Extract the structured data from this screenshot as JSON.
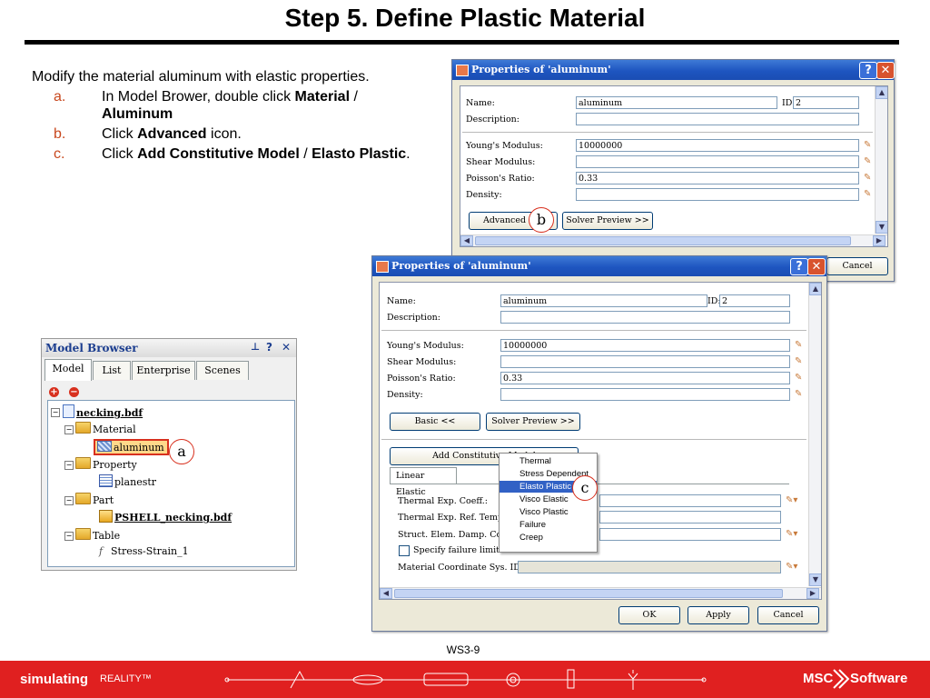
{
  "slide": {
    "title": "Step 5. Define Plastic Material",
    "intro": "Modify the material aluminum with elastic properties.",
    "steps": [
      {
        "marker": "a.",
        "parts": [
          "In Model Brower, double click ",
          "Material",
          " / ",
          "Aluminum"
        ]
      },
      {
        "marker": "b.",
        "parts": [
          "Click ",
          "Advanced",
          " icon."
        ]
      },
      {
        "marker": "c.",
        "parts": [
          "Click ",
          "Add Constitutive Model",
          " / ",
          "Elasto Plastic",
          "."
        ]
      }
    ],
    "page_label": "WS3-9"
  },
  "dialog_back": {
    "title": "Properties of 'aluminum'",
    "help": "?",
    "close": "✕",
    "name_label": "Name:",
    "name_value": "aluminum",
    "id_label": "ID:",
    "id_value": "2",
    "description_label": "Description:",
    "youngs_label": "Young's Modulus:",
    "youngs_value": "10000000",
    "shear_label": "Shear Modulus:",
    "poisson_label": "Poisson's Ratio:",
    "poisson_value": "0.33",
    "density_label": "Density:",
    "advanced_button": "Advanced >>",
    "solver_preview_button": "Solver Preview >>",
    "cancel_button": "Cancel",
    "callout": "b"
  },
  "dialog_front": {
    "title": "Properties of 'aluminum'",
    "help": "?",
    "close": "✕",
    "name_label": "Name:",
    "name_value": "aluminum",
    "id_label": "ID:",
    "id_value": "2",
    "description_label": "Description:",
    "youngs_label": "Young's Modulus:",
    "youngs_value": "10000000",
    "shear_label": "Shear Modulus:",
    "poisson_label": "Poisson's Ratio:",
    "poisson_value": "0.33",
    "density_label": "Density:",
    "basic_button": "Basic <<",
    "solver_preview_button": "Solver Preview >>",
    "add_constitutive_button": "Add Constitutive Model",
    "tab_linear_elastic": "Linear Elastic",
    "thermal_exp_label": "Thermal Exp. Coeff.:",
    "thermal_ref_label": "Thermal Exp. Ref. Temp.:",
    "struct_damp_label": "Struct. Elem. Damp. Coeff.:",
    "failure_limits_label": "Specify failure limits",
    "material_coord_label": "Material Coordinate Sys. ID:",
    "ok_button": "OK",
    "apply_button": "Apply",
    "cancel_button": "Cancel",
    "callout": "c",
    "menu_items": [
      "Thermal",
      "Stress Dependent",
      "Elasto Plastic",
      "Visco Elastic",
      "Visco Plastic",
      "Failure",
      "Creep"
    ],
    "menu_selected": "Elasto Plastic"
  },
  "model_browser": {
    "title": "Model Browser",
    "header_icons": [
      "pin-icon",
      "help-icon",
      "close-icon"
    ],
    "tabs": [
      "Model",
      "List",
      "Enterprise",
      "Scenes"
    ],
    "active_tab": "Model",
    "tree": {
      "root": "necking.bdf",
      "material": "Material",
      "material_item": "aluminum",
      "property": "Property",
      "property_item": "planestr",
      "part": "Part",
      "part_item": "PSHELL_necking.bdf",
      "table": "Table",
      "table_item": "Stress-Strain_1"
    },
    "callout": "a"
  },
  "footer": {
    "left_text": "simulating",
    "left_text2": "REALITY™",
    "brand_left": "MSC",
    "brand_right": "Software"
  },
  "colors": {
    "footer": "#e02020",
    "step_marker": "#c8481e",
    "callout_ring": "#d8301e",
    "titlebar": "#1e55c0"
  }
}
